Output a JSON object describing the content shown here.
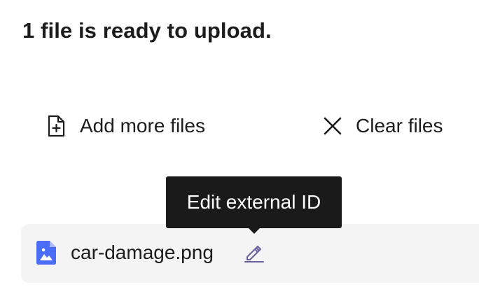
{
  "header": {
    "title": "1 file is ready to upload."
  },
  "actions": {
    "add_more_label": "Add more files",
    "clear_label": "Clear files"
  },
  "tooltip": {
    "text": "Edit external ID"
  },
  "files": [
    {
      "name": "car-damage.png",
      "icon": "image-file-icon"
    }
  ],
  "colors": {
    "file_icon": "#4a6cf7",
    "edit_icon": "#6b5e9e",
    "tooltip_bg": "#1a1a1a",
    "row_bg": "#f4f4f4"
  }
}
